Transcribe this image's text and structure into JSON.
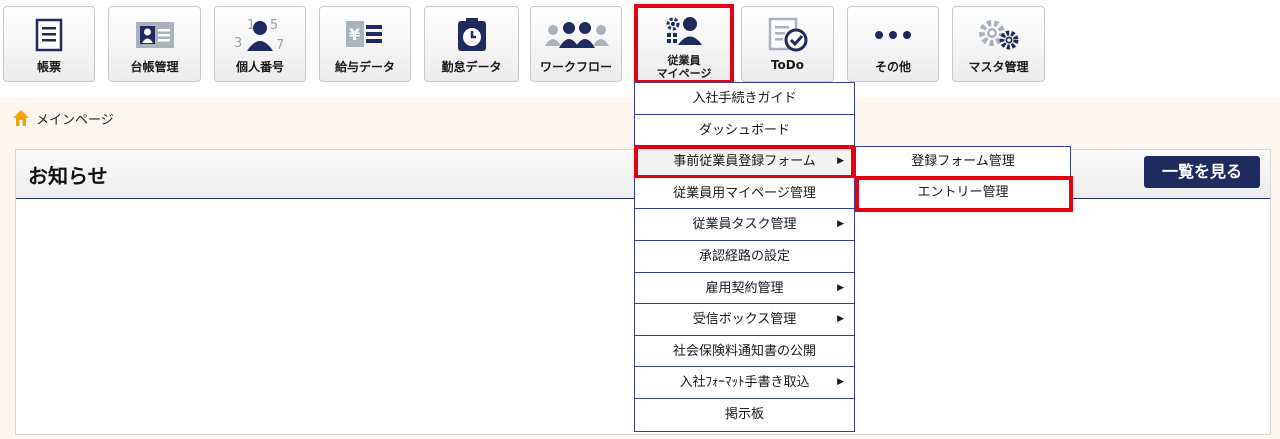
{
  "toolbar": {
    "buttons": [
      {
        "id": "ledger-forms",
        "label": "帳票",
        "icon": "document-list-icon"
      },
      {
        "id": "register-mgmt",
        "label": "台帳管理",
        "icon": "id-card-icon"
      },
      {
        "id": "my-number",
        "label": "個人番号",
        "icon": "person-number-icon"
      },
      {
        "id": "payroll-data",
        "label": "給与データ",
        "icon": "yen-list-icon"
      },
      {
        "id": "attendance-data",
        "label": "勤怠データ",
        "icon": "time-clock-icon"
      },
      {
        "id": "workflow",
        "label": "ワークフロー",
        "icon": "people-flow-icon"
      },
      {
        "id": "employee-mypage",
        "label_line1": "従業員",
        "label_line2": "マイページ",
        "icon": "employee-gear-icon",
        "active": true
      },
      {
        "id": "todo",
        "label": "ToDo",
        "icon": "checklist-icon"
      },
      {
        "id": "others",
        "label": "その他",
        "icon": "more-dots-icon"
      },
      {
        "id": "master-mgmt",
        "label": "マスタ管理",
        "icon": "gears-icon"
      }
    ]
  },
  "breadcrumb": {
    "label": "メインページ",
    "icon": "home-icon"
  },
  "panel": {
    "title": "お知らせ",
    "view_all": "一覧を見る"
  },
  "menu": {
    "items": [
      {
        "label": "入社手続きガイド",
        "submenu": false
      },
      {
        "label": "ダッシュボード",
        "submenu": false
      },
      {
        "label": "事前従業員登録フォーム",
        "submenu": true,
        "highlighted": true
      },
      {
        "label": "従業員用マイページ管理",
        "submenu": false
      },
      {
        "label": "従業員タスク管理",
        "submenu": true
      },
      {
        "label": "承認経路の設定",
        "submenu": false
      },
      {
        "label": "雇用契約管理",
        "submenu": true
      },
      {
        "label": "受信ボックス管理",
        "submenu": true
      },
      {
        "label": "社会保険料通知書の公開",
        "submenu": false
      },
      {
        "label": "入社ﾌｫｰﾏｯﾄ手書き取込",
        "submenu": true
      },
      {
        "label": "掲示板",
        "submenu": false
      }
    ],
    "submenu_items": [
      {
        "label": "登録フォーム管理"
      },
      {
        "label": "エントリー管理",
        "highlighted": true
      }
    ]
  },
  "colors": {
    "accent_red": "#e60012",
    "navy": "#1f2a5e",
    "icon_navy": "#1f2a5e",
    "main_bg": "#fdf6ee"
  }
}
